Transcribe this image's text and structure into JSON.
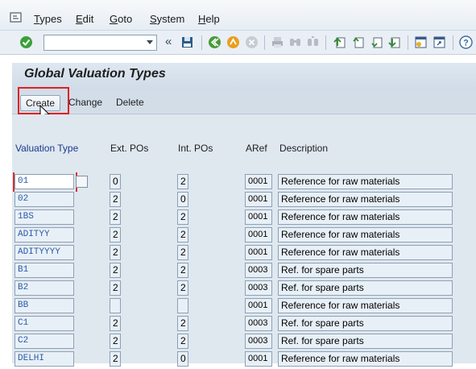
{
  "menu": {
    "items": [
      "Types",
      "Edit",
      "Goto",
      "System",
      "Help"
    ]
  },
  "toolbar": {
    "command_value": "",
    "back_glyph": "«"
  },
  "page": {
    "title": "Global Valuation Types"
  },
  "actions": {
    "create": "Create",
    "change": "Change",
    "delete": "Delete"
  },
  "table": {
    "headers": [
      "Valuation Type",
      "Ext. POs",
      "Int. POs",
      "ARef",
      "Description"
    ],
    "rows": [
      {
        "vt": "01",
        "ext": "0",
        "int": "2",
        "aref": "0001",
        "desc": "Reference for raw materials"
      },
      {
        "vt": "02",
        "ext": "2",
        "int": "0",
        "aref": "0001",
        "desc": "Reference for raw materials"
      },
      {
        "vt": "1BS",
        "ext": "2",
        "int": "2",
        "aref": "0001",
        "desc": "Reference for raw materials"
      },
      {
        "vt": "ADITYY",
        "ext": "2",
        "int": "2",
        "aref": "0001",
        "desc": "Reference for raw materials"
      },
      {
        "vt": "ADITYYYY",
        "ext": "2",
        "int": "2",
        "aref": "0001",
        "desc": "Reference for raw materials"
      },
      {
        "vt": "B1",
        "ext": "2",
        "int": "2",
        "aref": "0003",
        "desc": "Ref. for spare parts"
      },
      {
        "vt": "B2",
        "ext": "2",
        "int": "2",
        "aref": "0003",
        "desc": "Ref. for spare parts"
      },
      {
        "vt": "BB",
        "ext": "",
        "int": "",
        "aref": "0001",
        "desc": "Reference for raw materials"
      },
      {
        "vt": "C1",
        "ext": "2",
        "int": "2",
        "aref": "0003",
        "desc": "Ref. for spare parts"
      },
      {
        "vt": "C2",
        "ext": "2",
        "int": "2",
        "aref": "0003",
        "desc": "Ref. for spare parts"
      },
      {
        "vt": "DELHI",
        "ext": "2",
        "int": "0",
        "aref": "0001",
        "desc": "Reference for raw materials"
      }
    ]
  },
  "colors": {
    "highlight": "#e02020",
    "key_text": "#1a3a8c",
    "field_bg": "#e8f0f7"
  }
}
